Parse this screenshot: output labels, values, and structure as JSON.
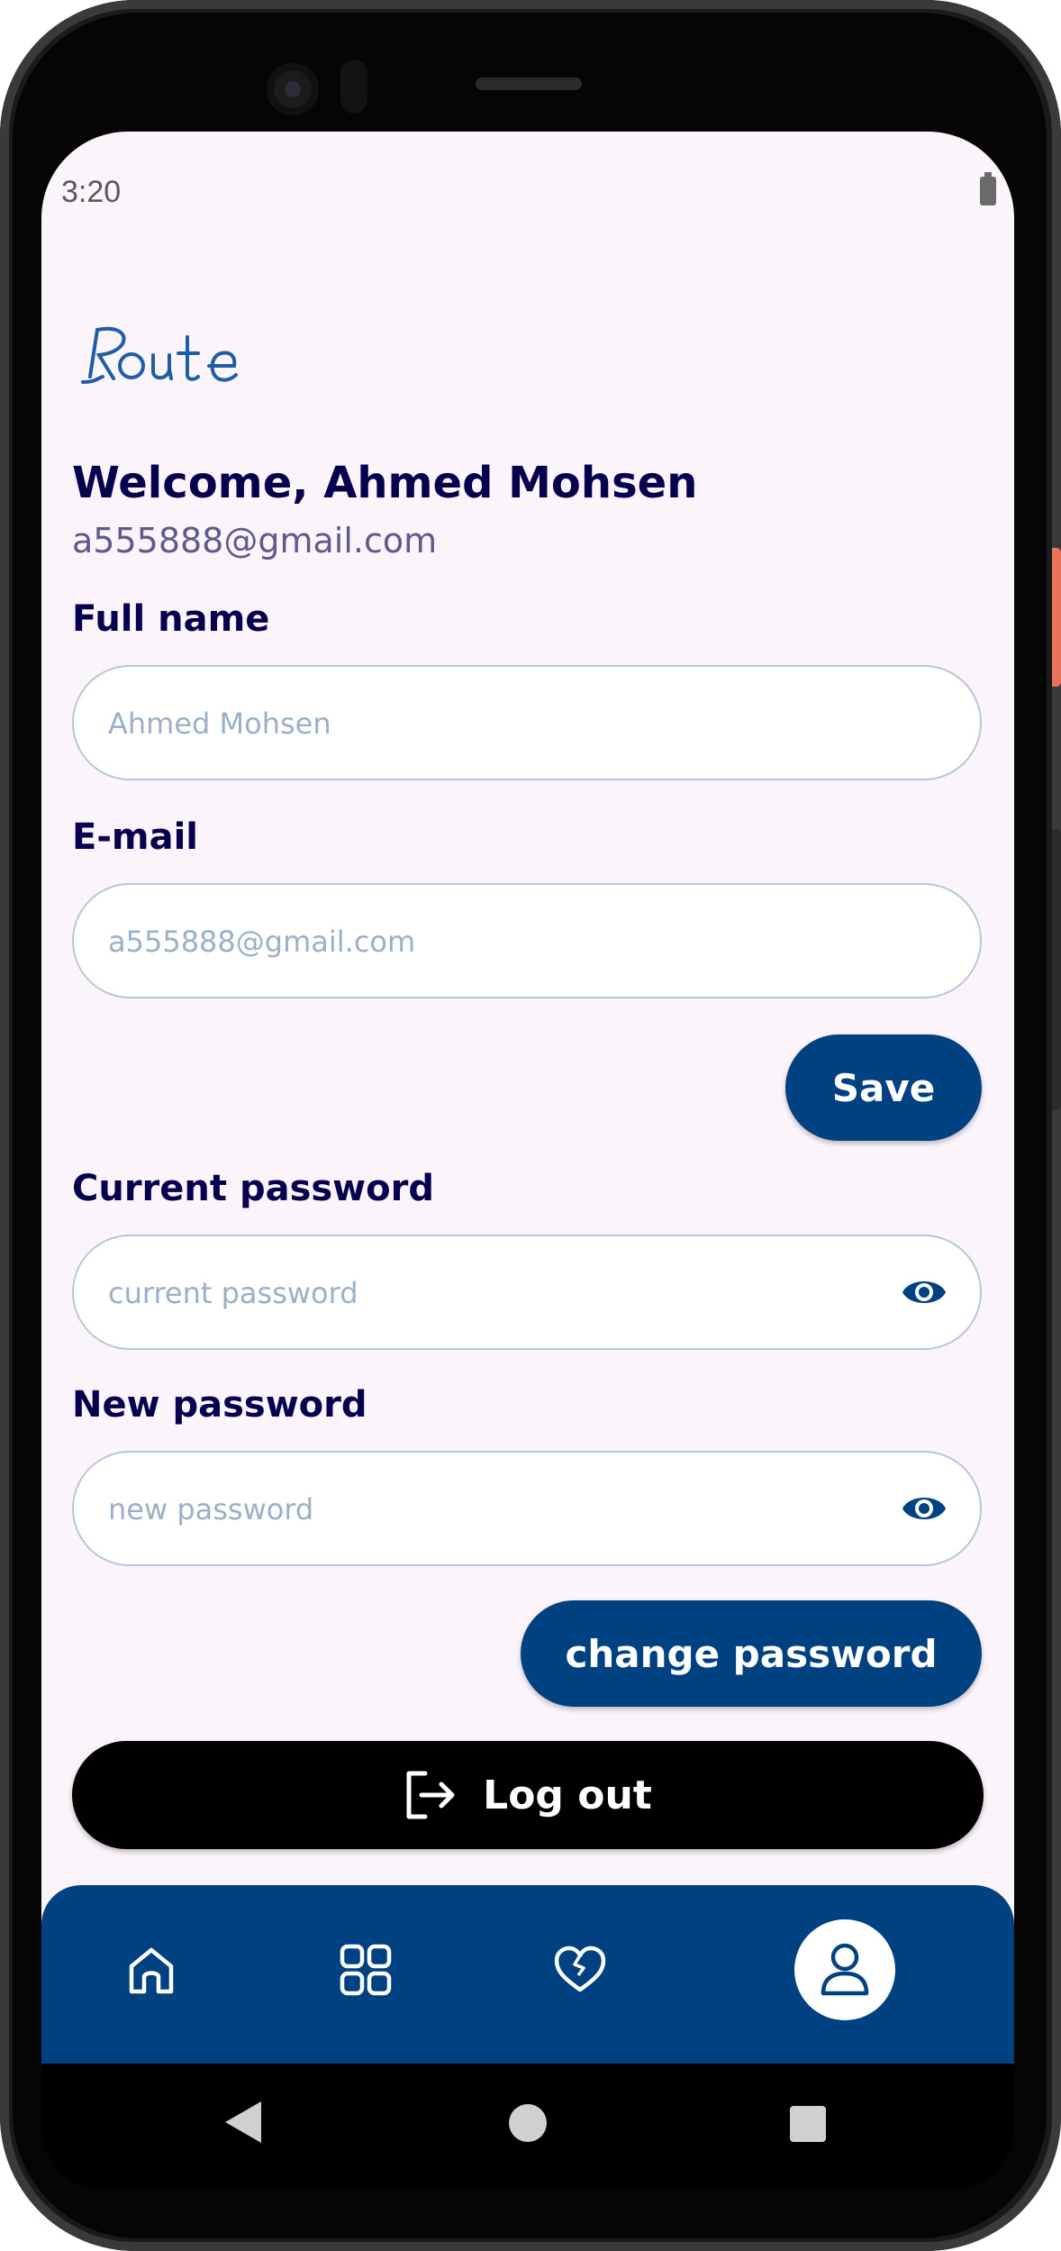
{
  "status_bar": {
    "time": "3:20"
  },
  "header": {
    "logo_text": "Route",
    "welcome": "Welcome, Ahmed Mohsen",
    "email": "a555888@gmail.com"
  },
  "profile_form": {
    "full_name_label": "Full name",
    "full_name_value": "Ahmed Mohsen",
    "email_label": "E-mail",
    "email_value": "a555888@gmail.com",
    "save_label": "Save"
  },
  "password_form": {
    "current_label": "Current password",
    "current_placeholder": "current password",
    "new_label": "New password",
    "new_placeholder": "new password",
    "change_label": "change password"
  },
  "logout_label": "Log out",
  "bottom_nav": {
    "items": [
      {
        "icon": "home-icon",
        "active": false
      },
      {
        "icon": "grid-icon",
        "active": false
      },
      {
        "icon": "heart-icon",
        "active": false
      },
      {
        "icon": "person-icon",
        "active": true
      }
    ]
  },
  "colors": {
    "primary": "#004182",
    "text_dark": "#06004f",
    "background": "#fcf4fb"
  }
}
